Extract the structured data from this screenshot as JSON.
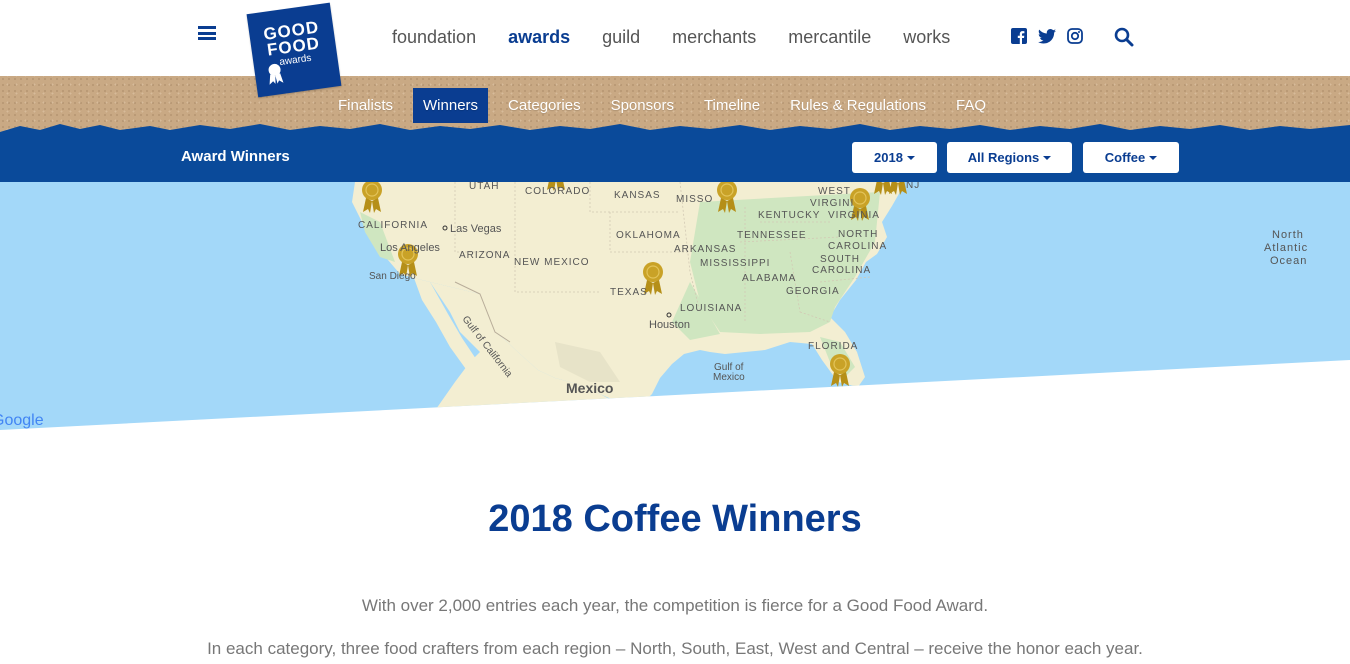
{
  "logo": {
    "line1": "GOOD",
    "line2": "FOOD",
    "line3": "awards"
  },
  "main_nav": [
    {
      "label": "foundation",
      "active": false
    },
    {
      "label": "awards",
      "active": true
    },
    {
      "label": "guild",
      "active": false
    },
    {
      "label": "merchants",
      "active": false
    },
    {
      "label": "mercantile",
      "active": false
    },
    {
      "label": "works",
      "active": false
    }
  ],
  "social": {
    "facebook_icon": "facebook-icon",
    "twitter_icon": "twitter-icon",
    "instagram_icon": "instagram-icon"
  },
  "sub_nav": [
    {
      "label": "Finalists",
      "active": false
    },
    {
      "label": "Winners",
      "active": true
    },
    {
      "label": "Categories",
      "active": false
    },
    {
      "label": "Sponsors",
      "active": false
    },
    {
      "label": "Timeline",
      "active": false
    },
    {
      "label": "Rules & Regulations",
      "active": false
    },
    {
      "label": "FAQ",
      "active": false
    }
  ],
  "award_bar": {
    "title": "Award Winners",
    "year": "2018",
    "region": "All Regions",
    "category": "Coffee"
  },
  "map": {
    "labels": {
      "utah": "UTAH",
      "colorado": "COLORADO",
      "kansas": "KANSAS",
      "missouri": "MISSO",
      "west_virginia_1": "WEST",
      "west_virginia_2": "VIRGINI",
      "kentucky": "KENTUCKY",
      "virginia": "VIRGINIA",
      "california": "CALIFORNIA",
      "las_vegas": "Las Vegas",
      "arizona": "ARIZONA",
      "los_angeles": "Los Angeles",
      "san_diego": "San Diego",
      "new_mexico": "NEW MEXICO",
      "oklahoma": "OKLAHOMA",
      "arkansas": "ARKANSAS",
      "tennessee": "TENNESSEE",
      "north_carolina_1": "NORTH",
      "north_carolina_2": "CAROLINA",
      "mississippi": "MISSISSIPPI",
      "south_carolina_1": "SOUTH",
      "south_carolina_2": "CAROLINA",
      "alabama": "ALABAMA",
      "georgia": "GEORGIA",
      "texas": "TEXAS",
      "louisiana": "LOUISIANA",
      "houston": "Houston",
      "florida": "FLORIDA",
      "gulf_of_mexico_1": "Gulf of",
      "gulf_of_mexico_2": "Mexico",
      "gulf_of_california": "Gulf of California",
      "mexico": "Mexico",
      "nj": "NJ",
      "north_atlantic_1": "North",
      "north_atlantic_2": "Atlantic",
      "north_atlantic_3": "Ocean",
      "google": "Google"
    },
    "colors": {
      "ocean": "#a3d8f9",
      "land": "#f3eed2",
      "land_green": "#cfe6c0",
      "pin": "#c9a227"
    }
  },
  "content": {
    "heading": "2018 Coffee Winners",
    "para1": "With over 2,000 entries each year, the competition is fierce for a Good Food Award.",
    "para2": "In each category, three food crafters from each region – North, South, East, West and Central – receive the honor each year."
  }
}
